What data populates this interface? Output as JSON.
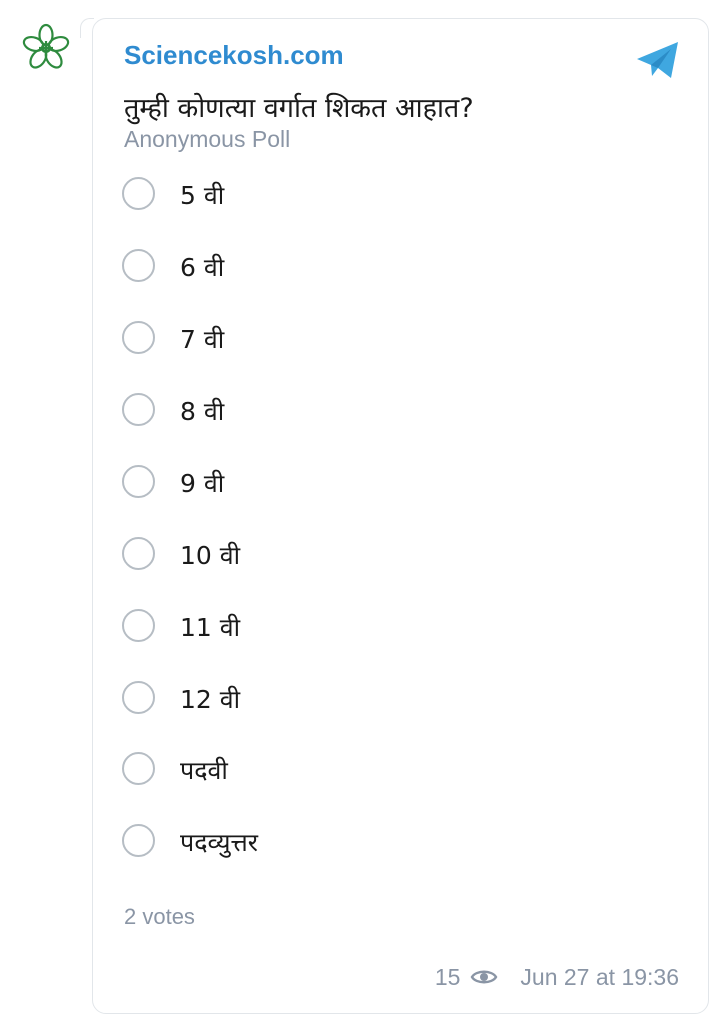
{
  "channel": {
    "name": "Sciencekosh.com"
  },
  "poll": {
    "question": "तुम्ही कोणत्या वर्गात शिकत आहात?",
    "type_label": "Anonymous Poll",
    "options": [
      {
        "label": "5 वी"
      },
      {
        "label": "6 वी"
      },
      {
        "label": "7 वी"
      },
      {
        "label": "8 वी"
      },
      {
        "label": "9 वी"
      },
      {
        "label": "10 वी"
      },
      {
        "label": "11 वी"
      },
      {
        "label": "12 वी"
      },
      {
        "label": "पदवी"
      },
      {
        "label": "पदव्युत्तर"
      }
    ],
    "votes_label": "2 votes"
  },
  "meta": {
    "views": "15",
    "timestamp": "Jun 27 at 19:36"
  },
  "colors": {
    "accent": "#2f8bd0",
    "secondary_text": "#8a95a5",
    "radio_border": "#b6bdc4",
    "logo_green": "#2e8b3e",
    "telegram_blue": "#3fa7e0"
  },
  "icons": {
    "avatar": "flower-logo-icon",
    "share": "telegram-share-icon",
    "views": "eye-icon"
  }
}
